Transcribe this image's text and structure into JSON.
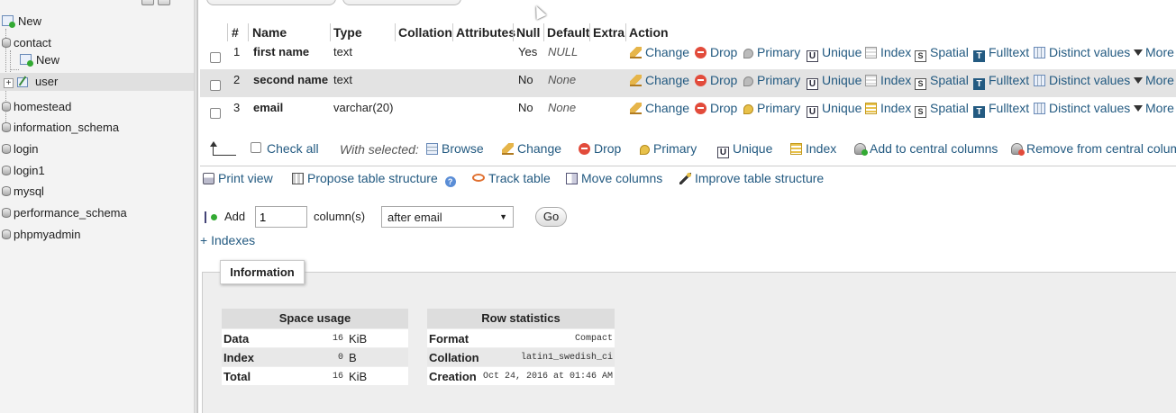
{
  "nav": {
    "top_new": "New",
    "contact": "contact",
    "contact_new": "New",
    "user": "user",
    "databases": [
      "homestead",
      "information_schema",
      "login",
      "login1",
      "mysql",
      "performance_schema",
      "phpmyadmin"
    ]
  },
  "structure": {
    "headers": {
      "num": "#",
      "name": "Name",
      "type": "Type",
      "collation": "Collation",
      "attributes": "Attributes",
      "null": "Null",
      "default": "Default",
      "extra": "Extra",
      "action": "Action"
    },
    "rows": [
      {
        "num": "1",
        "name": "first name",
        "type": "text",
        "null": "Yes",
        "default": "NULL"
      },
      {
        "num": "2",
        "name": "second name",
        "type": "text",
        "null": "No",
        "default": "None"
      },
      {
        "num": "3",
        "name": "email",
        "type": "varchar(20)",
        "null": "No",
        "default": "None"
      }
    ],
    "actions": {
      "change": "Change",
      "drop": "Drop",
      "primary": "Primary",
      "unique": "Unique",
      "index": "Index",
      "spatial": "Spatial",
      "fulltext": "Fulltext",
      "distinct": "Distinct values",
      "more": "More"
    }
  },
  "with_selected": {
    "check_all": "Check all",
    "label": "With selected:",
    "browse": "Browse",
    "change": "Change",
    "drop": "Drop",
    "primary": "Primary",
    "unique": "Unique",
    "index": "Index",
    "add_central": "Add to central columns",
    "remove_central": "Remove from central columns"
  },
  "tools": {
    "print": "Print view",
    "propose": "Propose table structure",
    "track": "Track table",
    "move": "Move columns",
    "improve": "Improve table structure"
  },
  "add_column": {
    "add": "Add",
    "count": "1",
    "suffix": "column(s)",
    "position": "after email",
    "go": "Go"
  },
  "indexes_link": "+ Indexes",
  "information": {
    "legend": "Information",
    "space_usage": {
      "title": "Space usage",
      "rows": [
        {
          "key": "Data",
          "value": "16",
          "unit": "KiB"
        },
        {
          "key": "Index",
          "value": "0",
          "unit": "B"
        },
        {
          "key": "Total",
          "value": "16",
          "unit": "KiB"
        }
      ]
    },
    "row_statistics": {
      "title": "Row statistics",
      "rows": [
        {
          "key": "Format",
          "value": "Compact"
        },
        {
          "key": "Collation",
          "value": "latin1_swedish_ci"
        },
        {
          "key": "Creation",
          "value": "Oct 24, 2016 at 01:46 AM"
        }
      ]
    }
  },
  "colors": {
    "link": "#235a81",
    "row_alt": "#e3e3e3",
    "nav_bg": "#f3f3f3"
  }
}
